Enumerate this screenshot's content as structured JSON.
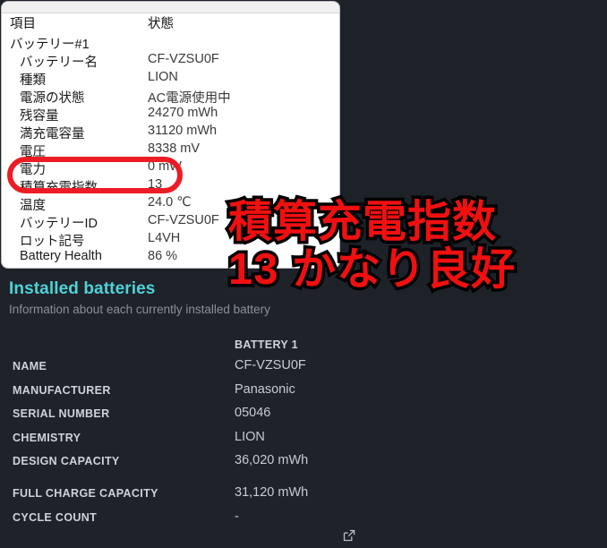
{
  "settings": {
    "section_title": "Installed batteries",
    "section_subtitle": "Information about each currently installed battery",
    "column_header": "BATTERY 1",
    "rows": [
      {
        "label": "NAME",
        "value": "CF-VZSU0F"
      },
      {
        "label": "MANUFACTURER",
        "value": "Panasonic"
      },
      {
        "label": "SERIAL NUMBER",
        "value": "05046"
      },
      {
        "label": "CHEMISTRY",
        "value": "LION"
      },
      {
        "label": "DESIGN CAPACITY",
        "value": "36,020 mWh"
      },
      {
        "label": "FULL CHARGE CAPACITY",
        "value": "31,120 mWh"
      },
      {
        "label": "CYCLE COUNT",
        "value": "-"
      }
    ],
    "external_link_icon": "external-link-icon"
  },
  "battery_window": {
    "header_item": "項目",
    "header_state": "状態",
    "rows": [
      {
        "key": "バッテリー#1",
        "value": "",
        "indent": 0
      },
      {
        "key": "バッテリー名",
        "value": "CF-VZSU0F",
        "indent": 1
      },
      {
        "key": "種類",
        "value": "LION",
        "indent": 1
      },
      {
        "key": "電源の状態",
        "value": "AC電源使用中",
        "indent": 1
      },
      {
        "key": "残容量",
        "value": "24270 mWh",
        "indent": 1
      },
      {
        "key": "満充電容量",
        "value": "31120 mWh",
        "indent": 1
      },
      {
        "key": "電圧",
        "value": "8338 mV",
        "indent": 1
      },
      {
        "key": "電力",
        "value": "0 mW",
        "indent": 1
      },
      {
        "key": "積算充電指数",
        "value": "13",
        "indent": 1
      },
      {
        "key": "温度",
        "value": "24.0 ℃",
        "indent": 1
      },
      {
        "key": "バッテリーID",
        "value": "CF-VZSU0F",
        "indent": 1
      },
      {
        "key": "ロット記号",
        "value": "L4VH",
        "indent": 1
      },
      {
        "key": "Battery Health",
        "value": "86 %",
        "indent": 1
      }
    ]
  },
  "annotation": {
    "caption_line1": "積算充電指数",
    "caption_line2": "13 かなり良好",
    "highlight_color": "#ed1c24",
    "caption_color": "#f01010",
    "accent_color": "#4cd3d8"
  }
}
